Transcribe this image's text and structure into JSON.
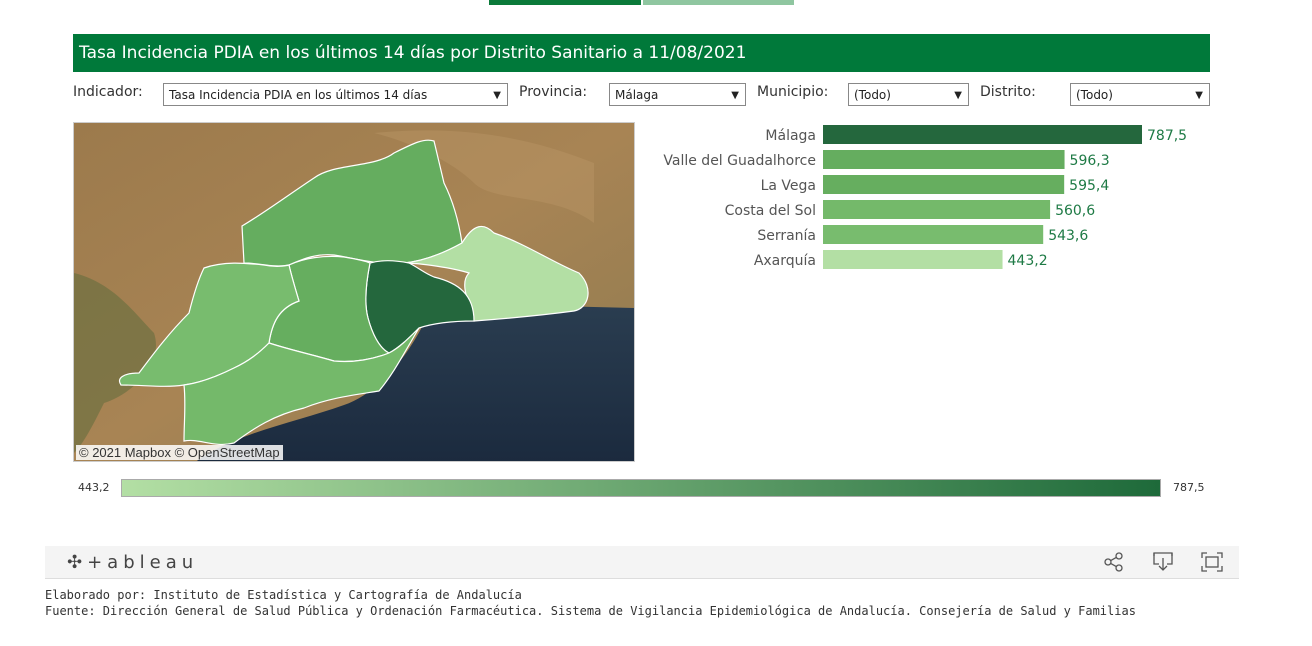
{
  "header": {
    "title": "Tasa Incidencia PDIA en los últimos 14 días por Distrito Sanitario a 11/08/2021"
  },
  "filters": [
    {
      "label": "Indicador:",
      "value": "Tasa Incidencia PDIA en los últimos 14 días"
    },
    {
      "label": "Provincia:",
      "value": "Málaga"
    },
    {
      "label": "Municipio:",
      "value": "(Todo)"
    },
    {
      "label": "Distrito:",
      "value": "(Todo)"
    }
  ],
  "map": {
    "attribution": "© 2021 Mapbox  © OpenStreetMap"
  },
  "legend": {
    "min_label": "443,2",
    "max_label": "787,5",
    "color_low": "#b3dfa4",
    "color_high": "#1e6a3a"
  },
  "chart_data": {
    "type": "bar",
    "orientation": "horizontal",
    "categories": [
      "Málaga",
      "Valle del Guadalhorce",
      "La Vega",
      "Costa del Sol",
      "Serranía",
      "Axarquía"
    ],
    "values": [
      787.5,
      596.3,
      595.4,
      560.6,
      543.6,
      443.2
    ],
    "value_labels": [
      "787,5",
      "596,3",
      "595,4",
      "560,6",
      "543,6",
      "443,2"
    ],
    "colors": [
      "#24673d",
      "#65ad5f",
      "#66ae5f",
      "#74b96a",
      "#78bc6e",
      "#b3dfa4"
    ],
    "xlim": [
      0,
      787.5
    ]
  },
  "footer": {
    "logo": "+ableau",
    "icons": [
      "share-icon",
      "download-icon",
      "fullscreen-icon"
    ]
  },
  "credits": {
    "line1": "Elaborado por: Instituto de Estadística y Cartografía de Andalucía",
    "line2": "Fuente: Dirección General de Salud Pública y Ordenación Farmacéutica. Sistema de Vigilancia Epidemiológica de Andalucía. Consejería de Salud y Familias"
  }
}
